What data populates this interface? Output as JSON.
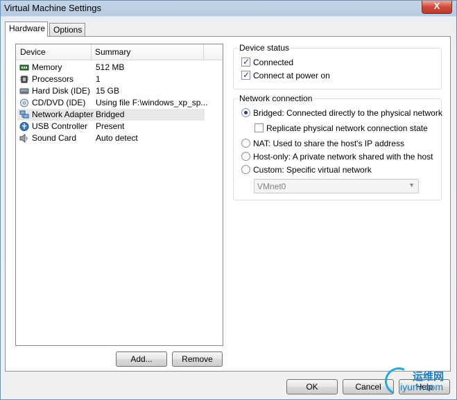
{
  "window": {
    "title": "Virtual Machine Settings",
    "close_label": "X"
  },
  "tabs": [
    {
      "label": "Hardware"
    },
    {
      "label": "Options"
    }
  ],
  "devices": {
    "col_device": "Device",
    "col_summary": "Summary",
    "rows": [
      {
        "name": "Memory",
        "summary": "512 MB",
        "icon": "memory-icon"
      },
      {
        "name": "Processors",
        "summary": "1",
        "icon": "processor-icon"
      },
      {
        "name": "Hard Disk (IDE)",
        "summary": "15 GB",
        "icon": "hard-disk-icon"
      },
      {
        "name": "CD/DVD (IDE)",
        "summary": "Using file F:\\windows_xp_sp...",
        "icon": "cd-dvd-icon"
      },
      {
        "name": "Network Adapter",
        "summary": "Bridged",
        "icon": "network-adapter-icon"
      },
      {
        "name": "USB Controller",
        "summary": "Present",
        "icon": "usb-icon"
      },
      {
        "name": "Sound Card",
        "summary": "Auto detect",
        "icon": "speaker-icon"
      }
    ],
    "selected_index": 4
  },
  "list_buttons": {
    "add": "Add...",
    "remove": "Remove"
  },
  "device_status": {
    "title": "Device status",
    "connected": {
      "label": "Connected",
      "checked": true
    },
    "connect_at_power_on": {
      "label": "Connect at power on",
      "checked": true
    }
  },
  "network_connection": {
    "title": "Network connection",
    "bridged": {
      "label": "Bridged: Connected directly to the physical network",
      "checked": true
    },
    "replicate": {
      "label": "Replicate physical network connection state",
      "checked": false
    },
    "nat": {
      "label": "NAT: Used to share the host's IP address",
      "checked": false
    },
    "host_only": {
      "label": "Host-only: A private network shared with the host",
      "checked": false
    },
    "custom": {
      "label": "Custom: Specific virtual network",
      "checked": false
    },
    "vmnet_select": {
      "value": "VMnet0"
    }
  },
  "dialog_buttons": {
    "ok": "OK",
    "cancel": "Cancel",
    "help": "Help"
  },
  "watermark": {
    "cn": "运维网",
    "en": "iyunv.com"
  },
  "colors": {
    "accent": "#1f3f7a",
    "selected_row": "#e8e8e8",
    "close_button": "#c0392b"
  }
}
